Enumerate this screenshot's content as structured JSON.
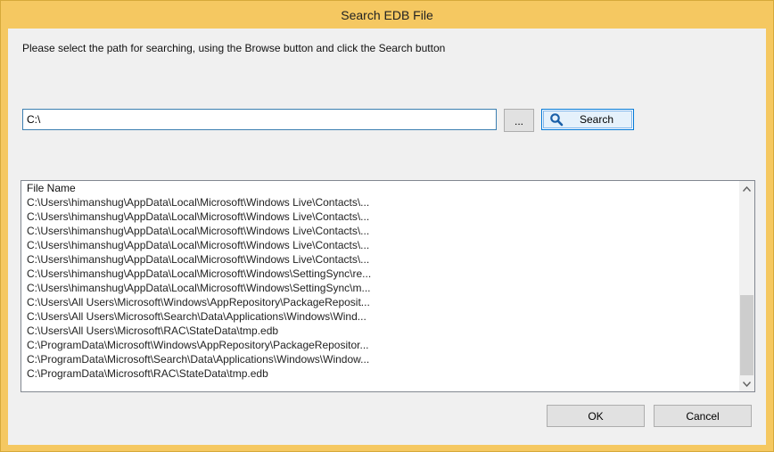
{
  "window": {
    "title": "Search EDB File"
  },
  "instruction": "Please select the path for searching, using the Browse button and click the Search button",
  "path_input": {
    "value": "C:\\"
  },
  "browse_button": {
    "label": "..."
  },
  "search_button": {
    "label": "Search",
    "icon": "magnifier-icon"
  },
  "results": {
    "header": "File Name",
    "rows": [
      "C:\\Users\\himanshug\\AppData\\Local\\Microsoft\\Windows Live\\Contacts\\...",
      "C:\\Users\\himanshug\\AppData\\Local\\Microsoft\\Windows Live\\Contacts\\...",
      "C:\\Users\\himanshug\\AppData\\Local\\Microsoft\\Windows Live\\Contacts\\...",
      "C:\\Users\\himanshug\\AppData\\Local\\Microsoft\\Windows Live\\Contacts\\...",
      "C:\\Users\\himanshug\\AppData\\Local\\Microsoft\\Windows Live\\Contacts\\...",
      "C:\\Users\\himanshug\\AppData\\Local\\Microsoft\\Windows\\SettingSync\\re...",
      "C:\\Users\\himanshug\\AppData\\Local\\Microsoft\\Windows\\SettingSync\\m...",
      "C:\\Users\\All Users\\Microsoft\\Windows\\AppRepository\\PackageReposit...",
      "C:\\Users\\All Users\\Microsoft\\Search\\Data\\Applications\\Windows\\Wind...",
      "C:\\Users\\All Users\\Microsoft\\RAC\\StateData\\tmp.edb",
      "C:\\ProgramData\\Microsoft\\Windows\\AppRepository\\PackageRepositor...",
      "C:\\ProgramData\\Microsoft\\Search\\Data\\Applications\\Windows\\Window...",
      "C:\\ProgramData\\Microsoft\\RAC\\StateData\\tmp.edb"
    ]
  },
  "ok_button": {
    "label": "OK"
  },
  "cancel_button": {
    "label": "Cancel"
  },
  "colors": {
    "frame": "#f5c861",
    "client": "#f0f0f0",
    "accent": "#0078d7"
  }
}
